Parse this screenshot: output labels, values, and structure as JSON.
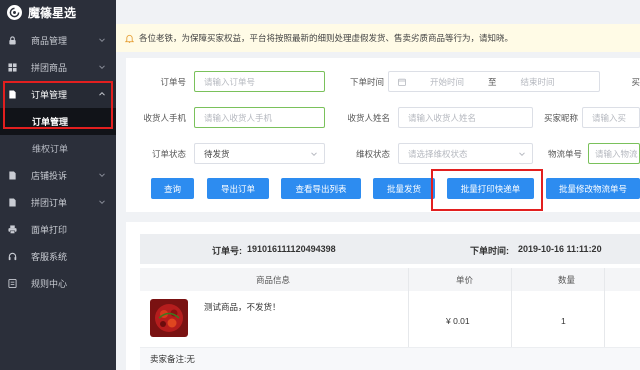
{
  "brand": {
    "name": "魔篠星选"
  },
  "sidebar": {
    "items": [
      {
        "label": "商品管理",
        "icon": "lock-icon",
        "has_chevron": true
      },
      {
        "label": "拼团商品",
        "icon": "grid-icon",
        "has_chevron": true
      },
      {
        "label": "订单管理",
        "icon": "document-icon",
        "has_chevron": true,
        "open": true
      },
      {
        "label": "店铺投诉",
        "icon": "file-icon",
        "has_chevron": true
      },
      {
        "label": "拼团订单",
        "icon": "file-icon",
        "has_chevron": true
      },
      {
        "label": "面单打印",
        "icon": "printer-icon",
        "has_chevron": false
      },
      {
        "label": "客服系统",
        "icon": "headset-icon",
        "has_chevron": false
      },
      {
        "label": "规则中心",
        "icon": "list-icon",
        "has_chevron": false
      }
    ],
    "sub_items": [
      {
        "label": "订单管理",
        "active": true
      },
      {
        "label": "维权订单",
        "active": false
      }
    ]
  },
  "notice": {
    "text": "各位老铁，为保障买家权益，平台将按照最新的细则处理虚假发货、售卖劣质商品等行为，请知晓。"
  },
  "filters": {
    "order_no": {
      "label": "订单号",
      "placeholder": "请输入订单号"
    },
    "order_time": {
      "label": "下单时间",
      "start_placeholder": "开始时间",
      "separator": "至",
      "end_placeholder": "结束时间"
    },
    "buyer_cut": {
      "label": "买"
    },
    "receiver_phone": {
      "label": "收货人手机",
      "placeholder": "请输入收货人手机"
    },
    "receiver_name": {
      "label": "收货人姓名",
      "placeholder": "请输入收货人姓名"
    },
    "buyer_nick": {
      "label": "买家昵称",
      "placeholder": "请输入买"
    },
    "order_status": {
      "label": "订单状态",
      "value": "待发货"
    },
    "rights_status": {
      "label": "维权状态",
      "placeholder": "请选择维权状态"
    },
    "tracking_no": {
      "label": "物流单号",
      "placeholder": "请输入物流"
    }
  },
  "buttons": {
    "query": "查询",
    "export_orders": "导出订单",
    "view_export_list": "查看导出列表",
    "batch_ship": "批量发货",
    "batch_print": "批量打印快递单",
    "batch_modify_tracking": "批量修改物流单号"
  },
  "order": {
    "order_no_label": "订单号:",
    "order_no": "191016111120494398",
    "time_label": "下单时间:",
    "time": "2019-10-16 11:11:20",
    "columns": [
      "商品信息",
      "单价",
      "数量"
    ],
    "product": {
      "name": "测试商品，不发货！",
      "price": "¥ 0.01",
      "qty": "1"
    },
    "remark_label": "卖家备注:",
    "remark": "无"
  },
  "colors": {
    "sidebar_bg": "#2b2f3a",
    "primary": "#2d8cf0",
    "highlight": "#e21f1f",
    "notice_bg": "#fffbe6"
  }
}
